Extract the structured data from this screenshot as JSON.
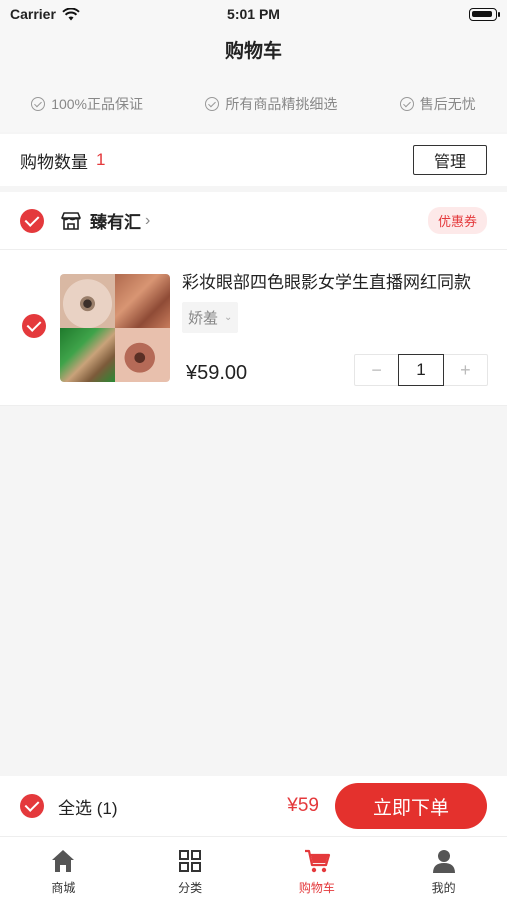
{
  "status_bar": {
    "carrier": "Carrier",
    "time": "5:01 PM"
  },
  "nav": {
    "title": "购物车"
  },
  "guarantees": [
    "100%正品保证",
    "所有商品精挑细选",
    "售后无忧"
  ],
  "cart_count": {
    "label": "购物数量",
    "value": "1",
    "manage_label": "管理"
  },
  "shop": {
    "name": "臻有汇",
    "coupon_label": "优惠券"
  },
  "item": {
    "title": "彩妆眼部四色眼影女学生直播网红同款",
    "spec": "娇羞",
    "price": "¥59.00",
    "quantity": "1"
  },
  "checkout": {
    "select_all_label": "全选 (1)",
    "total": "¥59",
    "order_label": "立即下单"
  },
  "tabs": [
    {
      "label": "商城",
      "icon": "home-icon"
    },
    {
      "label": "分类",
      "icon": "grid-icon"
    },
    {
      "label": "购物车",
      "icon": "cart-icon"
    },
    {
      "label": "我的",
      "icon": "user-icon"
    }
  ],
  "colors": {
    "accent": "#e4393c",
    "background": "#f5f5f5"
  }
}
